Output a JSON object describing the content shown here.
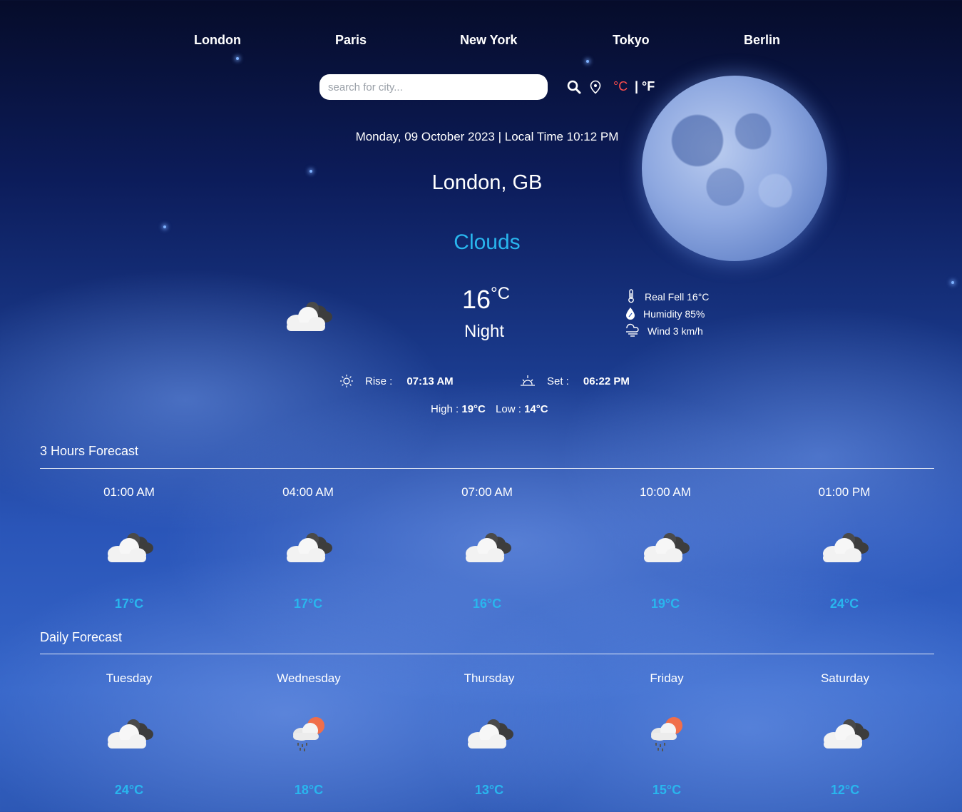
{
  "nav": {
    "cities": [
      "London",
      "Paris",
      "New York",
      "Tokyo",
      "Berlin"
    ]
  },
  "search": {
    "placeholder": "search for city..."
  },
  "units": {
    "celsius": "°C",
    "separator": "|",
    "fahrenheit": "°F",
    "active_color": "#ff4d4d"
  },
  "current": {
    "date_time": "Monday, 09 October 2023 | Local Time 10:12 PM",
    "location": "London, GB",
    "condition": "Clouds",
    "temperature": "16",
    "temperature_unit": "°C",
    "period": "Night",
    "icon": "cloudy-night-icon",
    "details": [
      {
        "icon": "thermometer-icon",
        "label": "Real Fell 16°C"
      },
      {
        "icon": "humidity-icon",
        "label": "Humidity 85%"
      },
      {
        "icon": "wind-icon",
        "label": "Wind 3 km/h"
      }
    ],
    "sunrise_label": "Rise :",
    "sunrise": "07:13 AM",
    "sunset_label": "Set :",
    "sunset": "06:22 PM",
    "high_label": "High :",
    "high": "19°C",
    "low_label": "Low :",
    "low": "14°C"
  },
  "hourly": {
    "title": "3 Hours Forecast",
    "items": [
      {
        "time": "01:00 AM",
        "icon": "cloudy-icon",
        "temp": "17°C"
      },
      {
        "time": "04:00 AM",
        "icon": "cloudy-icon",
        "temp": "17°C"
      },
      {
        "time": "07:00 AM",
        "icon": "cloudy-icon",
        "temp": "16°C"
      },
      {
        "time": "10:00 AM",
        "icon": "cloudy-icon",
        "temp": "19°C"
      },
      {
        "time": "01:00 PM",
        "icon": "cloudy-icon",
        "temp": "24°C"
      }
    ]
  },
  "daily": {
    "title": "Daily Forecast",
    "items": [
      {
        "day": "Tuesday",
        "icon": "cloudy-icon",
        "temp": "24°C"
      },
      {
        "day": "Wednesday",
        "icon": "sun-rain-icon",
        "temp": "18°C"
      },
      {
        "day": "Thursday",
        "icon": "cloudy-icon",
        "temp": "13°C"
      },
      {
        "day": "Friday",
        "icon": "sun-rain-icon",
        "temp": "15°C"
      },
      {
        "day": "Saturday",
        "icon": "cloudy-icon",
        "temp": "12°C"
      }
    ]
  },
  "colors": {
    "accent": "#29b6ee",
    "background_top": "#060c2a",
    "background_bottom": "#2d58b5"
  }
}
